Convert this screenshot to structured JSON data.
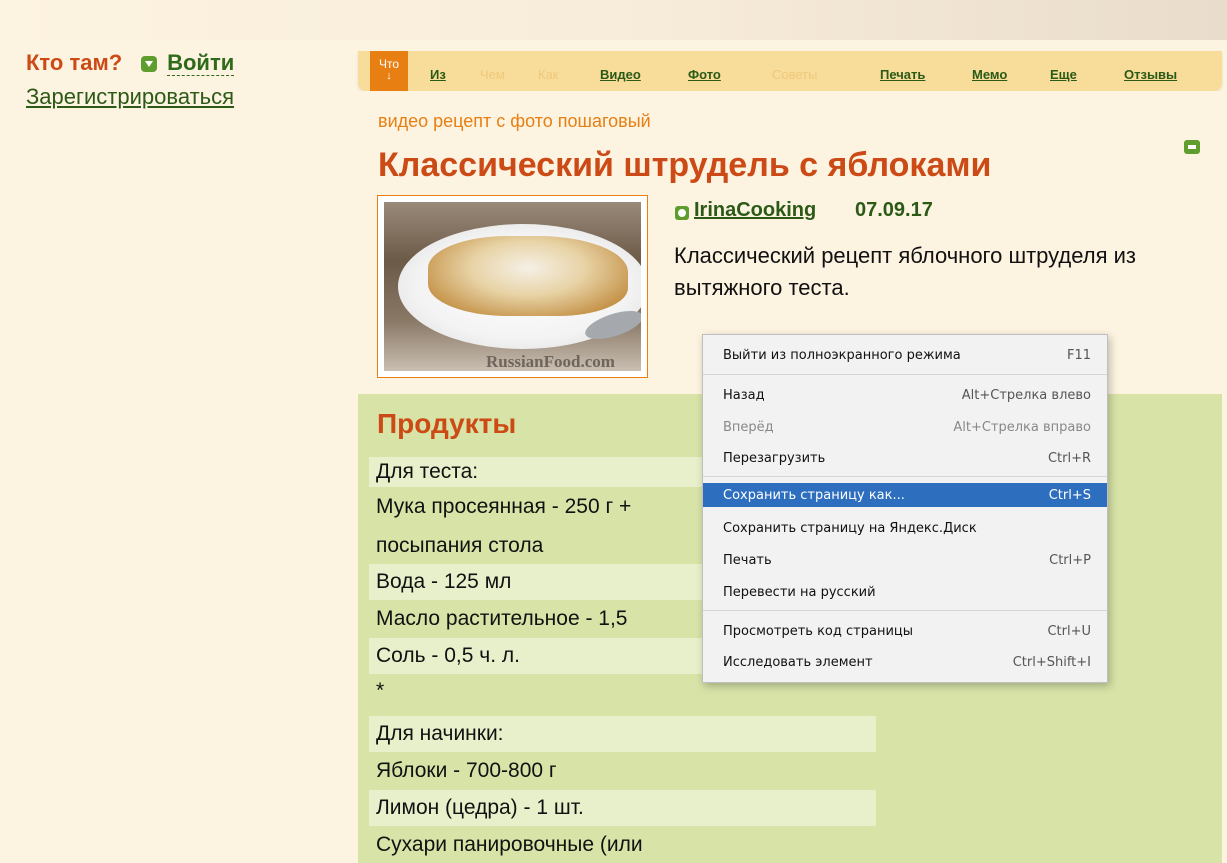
{
  "header": {
    "who_label": "Кто там?",
    "login_label": "Войти",
    "register_label": "Зарегистрироваться"
  },
  "nav": {
    "active_label": "Что",
    "active_arrow": "↓",
    "items": [
      {
        "label": "Из",
        "enabled": true
      },
      {
        "label": "Чем",
        "enabled": false
      },
      {
        "label": "Как",
        "enabled": false
      },
      {
        "label": "Видео",
        "enabled": true
      },
      {
        "label": "Фото",
        "enabled": true
      },
      {
        "label": "Советы",
        "enabled": false
      },
      {
        "label": "Печать",
        "enabled": true
      },
      {
        "label": "Мемо",
        "enabled": true
      },
      {
        "label": "Еще",
        "enabled": true
      },
      {
        "label": "Отзывы",
        "enabled": true
      }
    ]
  },
  "recipe": {
    "subtitle": "видео рецепт с фото пошаговый",
    "title": "Классический штрудель с яблоками",
    "author": "IrinaCooking",
    "date": "07.09.17",
    "description": "Классический рецепт яблочного штруделя из вытяжного теста.",
    "photo_watermark": "RussianFood.com"
  },
  "products": {
    "title": "Продукты",
    "rows": [
      "Для теста:",
      "Мука просеянная - 250 г +",
      "посыпания стола",
      "Вода - 125 мл",
      "Масло растительное - 1,5",
      "Соль - 0,5 ч. л.",
      "*",
      "Для начинки:",
      "Яблоки - 700-800 г",
      "Лимон (цедра) - 1 шт.",
      "Сухари панировочные (или"
    ]
  },
  "context_menu": {
    "items": [
      {
        "label": "Выйти из полноэкранного режима",
        "shortcut": "F11",
        "state": "normal"
      },
      {
        "label": "Назад",
        "shortcut": "Alt+Стрелка влево",
        "state": "normal"
      },
      {
        "label": "Вперёд",
        "shortcut": "Alt+Стрелка вправо",
        "state": "disabled"
      },
      {
        "label": "Перезагрузить",
        "shortcut": "Ctrl+R",
        "state": "normal"
      },
      {
        "label": "Сохранить страницу как...",
        "shortcut": "Ctrl+S",
        "state": "selected"
      },
      {
        "label": "Сохранить страницу на Яндекс.Диск",
        "shortcut": "",
        "state": "normal"
      },
      {
        "label": "Печать",
        "shortcut": "Ctrl+P",
        "state": "normal"
      },
      {
        "label": "Перевести на русский",
        "shortcut": "",
        "state": "normal"
      },
      {
        "label": "Просмотреть код страницы",
        "shortcut": "Ctrl+U",
        "state": "normal"
      },
      {
        "label": "Исследовать элемент",
        "shortcut": "Ctrl+Shift+I",
        "state": "normal"
      }
    ]
  },
  "colors": {
    "accent_orange": "#e87f12",
    "title_red": "#cc4a16",
    "link_green": "#2b5a16",
    "products_bg": "#d7e3a7",
    "menu_selected": "#2d6fbe"
  }
}
